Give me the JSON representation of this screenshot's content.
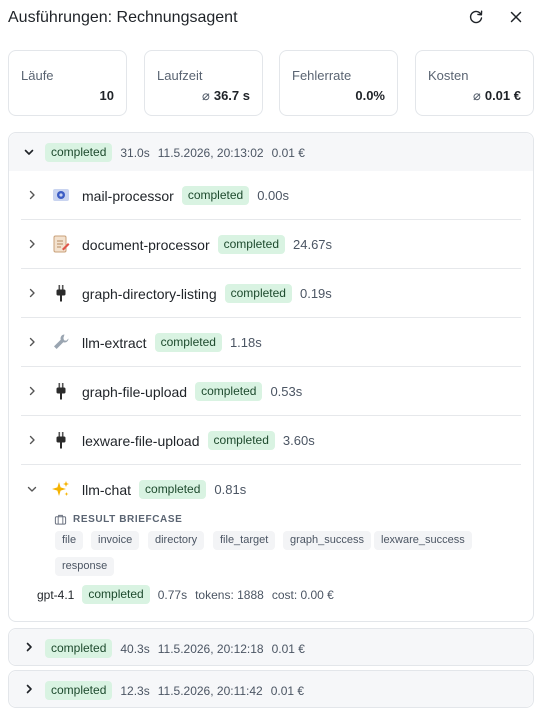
{
  "header": {
    "title": "Ausführungen: Rechnungsagent",
    "refresh_label": "refresh",
    "close_label": "close"
  },
  "stats": [
    {
      "label": "Läufe",
      "prefix": "",
      "value": "10"
    },
    {
      "label": "Laufzeit",
      "prefix": "⌀",
      "value": "36.7 s"
    },
    {
      "label": "Fehlerrate",
      "prefix": "",
      "value": "0.0%"
    },
    {
      "label": "Kosten",
      "prefix": "⌀",
      "value": "0.01 €"
    }
  ],
  "runs": [
    {
      "status": "completed",
      "duration": "31.0s",
      "timestamp": "11.5.2026, 20:13:02",
      "cost": "0.01 €",
      "expanded": true,
      "steps": [
        {
          "icon": "mail-icon",
          "name": "mail-processor",
          "status": "completed",
          "duration": "0.00s"
        },
        {
          "icon": "document-edit-icon",
          "name": "document-processor",
          "status": "completed",
          "duration": "24.67s"
        },
        {
          "icon": "plug-icon",
          "name": "graph-directory-listing",
          "status": "completed",
          "duration": "0.19s"
        },
        {
          "icon": "wrench-icon",
          "name": "llm-extract",
          "status": "completed",
          "duration": "1.18s"
        },
        {
          "icon": "plug-icon",
          "name": "graph-file-upload",
          "status": "completed",
          "duration": "0.53s"
        },
        {
          "icon": "plug-icon",
          "name": "lexware-file-upload",
          "status": "completed",
          "duration": "3.60s"
        },
        {
          "icon": "sparkles-icon",
          "name": "llm-chat",
          "status": "completed",
          "duration": "0.81s",
          "expanded": true
        }
      ],
      "briefcase": {
        "title": "RESULT BRIEFCASE",
        "chips": [
          "file",
          "invoice",
          "directory",
          "file_target",
          "graph_success",
          "lexware_success",
          "response"
        ]
      },
      "llm_call": {
        "model": "gpt-4.1",
        "status": "completed",
        "duration": "0.77s",
        "tokens": "tokens: 1888",
        "cost": "cost: 0.00 €"
      }
    },
    {
      "status": "completed",
      "duration": "40.3s",
      "timestamp": "11.5.2026, 20:12:18",
      "cost": "0.01 €",
      "expanded": false
    },
    {
      "status": "completed",
      "duration": "12.3s",
      "timestamp": "11.5.2026, 20:11:42",
      "cost": "0.01 €",
      "expanded": false
    }
  ],
  "colors": {
    "badge_bg": "#d9f3e2",
    "badge_text": "#1d4a2d",
    "border": "#e3e6ea",
    "header_bg": "#f6f7f9"
  }
}
